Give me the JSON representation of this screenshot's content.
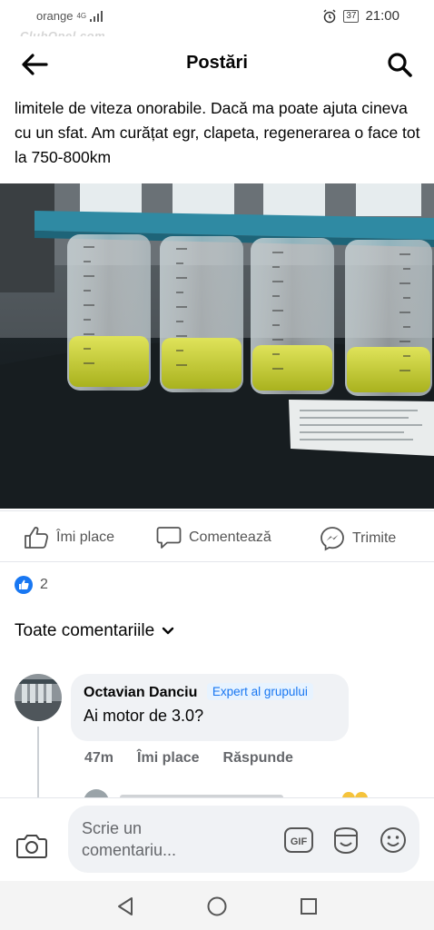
{
  "status": {
    "carrier": "orange",
    "network": "4G",
    "battery": "37",
    "time": "21:00"
  },
  "watermark": "ClubOpel.com",
  "header": {
    "title": "Postări",
    "back_icon": "arrow-left-icon",
    "search_icon": "search-icon"
  },
  "post": {
    "text": "limitele de viteza onorabile. Dacă ma poate ajuta cineva cu un sfat. Am curățat egr, clapeta, regenerarea o face tot la 750-800km"
  },
  "actions": {
    "like": "Îmi place",
    "comment": "Comentează",
    "share": "Trimite"
  },
  "reactions": {
    "count": "2"
  },
  "comments_header": "Toate comentariile",
  "comment": {
    "author": "Octavian Danciu",
    "badge": "Expert al grupului",
    "text": "Ai motor de 3.0?",
    "time": "47m",
    "like": "Îmi place",
    "reply": "Răspunde"
  },
  "composer": {
    "placeholder": "Scrie un comentariu...",
    "gif": "GIF"
  },
  "colors": {
    "accent": "#1877f2",
    "badge_bg": "#e7f3ff",
    "bubble_bg": "#f0f2f5",
    "muted_text": "#65676b"
  }
}
